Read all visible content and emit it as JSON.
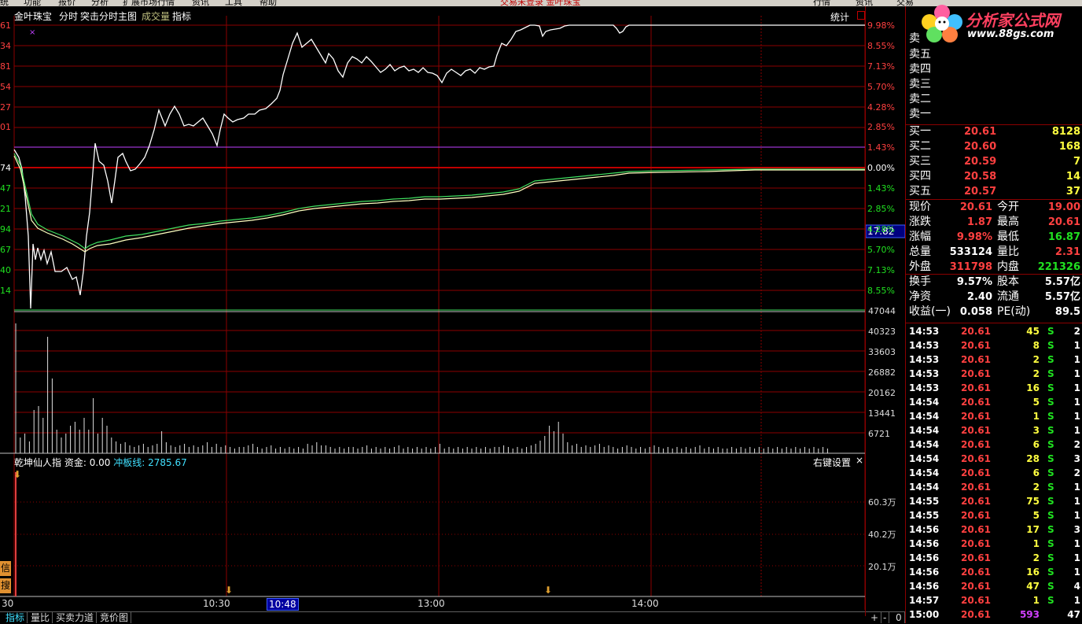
{
  "top_menu": {
    "items": [
      "统",
      "功能",
      "报价",
      "分析",
      "扩展市场行情",
      "资讯",
      "工具",
      "帮助"
    ],
    "center_text": "交易未登录  金叶珠宝",
    "right_items": [
      "行情",
      "资讯",
      "交易"
    ]
  },
  "chart_header": {
    "stock_name": "金叶珠宝",
    "view_label": "分时",
    "main_chart_label": "突击分时主图",
    "volume_label": "成交量",
    "indicator_label": "指标",
    "stats_button": "统计"
  },
  "price_axis_left": [
    "61",
    "34",
    "81",
    "54",
    "27",
    "01",
    "74",
    "47",
    "21",
    "94",
    "67",
    "40",
    "14"
  ],
  "price_axis_right": [
    "9.98%",
    "8.55%",
    "7.13%",
    "5.70%",
    "4.28%",
    "2.85%",
    "1.43%",
    "0.00%",
    "1.43%",
    "2.85%",
    "4.28%",
    "5.70%",
    "7.13%",
    "8.55%"
  ],
  "current_price_box": "17.82",
  "volume_axis": [
    "47044",
    "40323",
    "33603",
    "26882",
    "20162",
    "13441",
    "6721"
  ],
  "indicator": {
    "name": "乾坤仙人指",
    "funds_label": "资金:",
    "funds_value": "0.00",
    "line_label": "冲板线:",
    "line_value": "2785.67",
    "settings_label": "右键设置",
    "close_icon_glyph": "×",
    "axis": [
      "60.3万",
      "40.2万",
      "20.1万"
    ]
  },
  "side_buttons": [
    "信",
    "搜"
  ],
  "time_axis": {
    "labels": [
      "30",
      "10:30",
      "10:48",
      "13:00",
      "14:00"
    ]
  },
  "bottom_tabs": [
    "指标",
    "量比",
    "买卖力道",
    "竞价图"
  ],
  "bottom_right": [
    "+",
    "-",
    "0"
  ],
  "logo": {
    "title": "分析家公式网",
    "url": "www.88gs.com"
  },
  "order_book": {
    "sell_header": "卖",
    "sell": [
      {
        "label": "卖五",
        "price": "",
        "vol": ""
      },
      {
        "label": "卖四",
        "price": "",
        "vol": ""
      },
      {
        "label": "卖三",
        "price": "",
        "vol": ""
      },
      {
        "label": "卖二",
        "price": "",
        "vol": ""
      },
      {
        "label": "卖一",
        "price": "",
        "vol": ""
      }
    ],
    "buy": [
      {
        "label": "买一",
        "price": "20.61",
        "vol": "8128"
      },
      {
        "label": "买二",
        "price": "20.60",
        "vol": "168"
      },
      {
        "label": "买三",
        "price": "20.59",
        "vol": "7"
      },
      {
        "label": "买四",
        "price": "20.58",
        "vol": "14"
      },
      {
        "label": "买五",
        "price": "20.57",
        "vol": "37"
      }
    ]
  },
  "quote": [
    {
      "l1": "现价",
      "v1": "20.61",
      "l2": "今开",
      "v2": "19.00"
    },
    {
      "l1": "涨跌",
      "v1": "1.87",
      "l2": "最高",
      "v2": "20.61"
    },
    {
      "l1": "涨幅",
      "v1": "9.98%",
      "l2": "最低",
      "v2": "16.87"
    },
    {
      "l1": "总量",
      "v1": "533124",
      "l2": "量比",
      "v2": "2.31"
    },
    {
      "l1": "外盘",
      "v1": "311798",
      "l2": "内盘",
      "v2": "221326"
    },
    {
      "l1": "换手",
      "v1": "9.57%",
      "l2": "股本",
      "v2": "5.57亿"
    },
    {
      "l1": "净资",
      "v1": "2.40",
      "l2": "流通",
      "v2": "5.57亿"
    },
    {
      "l1": "收益(一)",
      "v1": "0.058",
      "l2": "PE(动)",
      "v2": "89.5"
    }
  ],
  "ticks": [
    {
      "time": "14:53",
      "price": "20.61",
      "vol": "45",
      "side": "S",
      "n": "2"
    },
    {
      "time": "14:53",
      "price": "20.61",
      "vol": "8",
      "side": "S",
      "n": "1"
    },
    {
      "time": "14:53",
      "price": "20.61",
      "vol": "2",
      "side": "S",
      "n": "1"
    },
    {
      "time": "14:53",
      "price": "20.61",
      "vol": "2",
      "side": "S",
      "n": "1"
    },
    {
      "time": "14:53",
      "price": "20.61",
      "vol": "16",
      "side": "S",
      "n": "1"
    },
    {
      "time": "14:54",
      "price": "20.61",
      "vol": "5",
      "side": "S",
      "n": "1"
    },
    {
      "time": "14:54",
      "price": "20.61",
      "vol": "1",
      "side": "S",
      "n": "1"
    },
    {
      "time": "14:54",
      "price": "20.61",
      "vol": "3",
      "side": "S",
      "n": "1"
    },
    {
      "time": "14:54",
      "price": "20.61",
      "vol": "6",
      "side": "S",
      "n": "2"
    },
    {
      "time": "14:54",
      "price": "20.61",
      "vol": "28",
      "side": "S",
      "n": "3"
    },
    {
      "time": "14:54",
      "price": "20.61",
      "vol": "6",
      "side": "S",
      "n": "2"
    },
    {
      "time": "14:54",
      "price": "20.61",
      "vol": "2",
      "side": "S",
      "n": "1"
    },
    {
      "time": "14:55",
      "price": "20.61",
      "vol": "75",
      "side": "S",
      "n": "1"
    },
    {
      "time": "14:55",
      "price": "20.61",
      "vol": "5",
      "side": "S",
      "n": "1"
    },
    {
      "time": "14:56",
      "price": "20.61",
      "vol": "17",
      "side": "S",
      "n": "3"
    },
    {
      "time": "14:56",
      "price": "20.61",
      "vol": "1",
      "side": "S",
      "n": "1"
    },
    {
      "time": "14:56",
      "price": "20.61",
      "vol": "2",
      "side": "S",
      "n": "1"
    },
    {
      "time": "14:56",
      "price": "20.61",
      "vol": "16",
      "side": "S",
      "n": "1"
    },
    {
      "time": "14:56",
      "price": "20.61",
      "vol": "47",
      "side": "S",
      "n": "4"
    },
    {
      "time": "14:57",
      "price": "20.61",
      "vol": "1",
      "side": "S",
      "n": "1"
    },
    {
      "time": "15:00",
      "price": "20.61",
      "vol": "593",
      "side": "",
      "n": "47"
    }
  ]
}
